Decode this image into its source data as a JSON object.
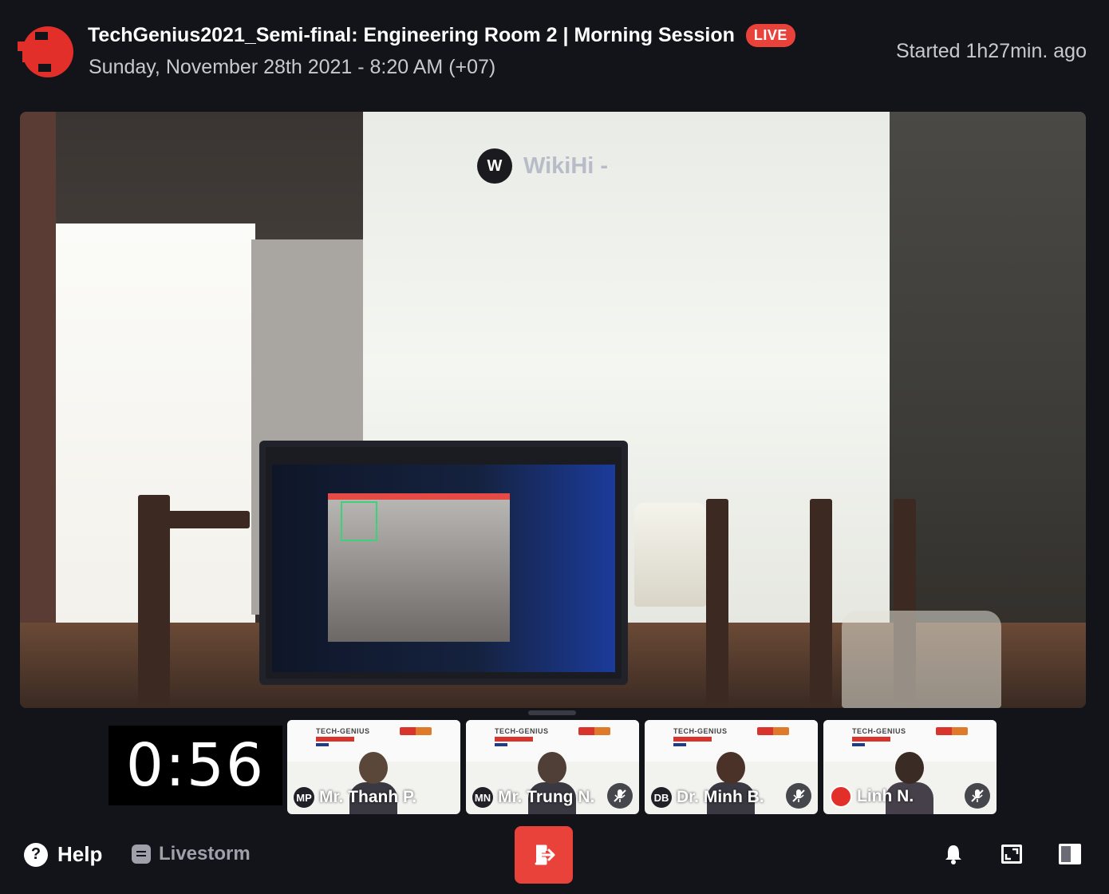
{
  "header": {
    "title": "TechGenius2021_Semi-final: Engineering Room 2 | Morning Session",
    "live_badge": "LIVE",
    "date": "Sunday, November 28th 2021 - 8:20 AM (+07)",
    "started": "Started 1h27min. ago"
  },
  "stage": {
    "speaker_initial": "W",
    "speaker_name": "WikiHi -"
  },
  "timer": "0:56",
  "participants": [
    {
      "initials": "MP",
      "name": "Mr. Thanh P.",
      "muted": false,
      "tile_brand": "TECH-GENIUS"
    },
    {
      "initials": "MN",
      "name": "Mr. Trung N.",
      "muted": true,
      "tile_brand": "TECH-GENIUS"
    },
    {
      "initials": "DB",
      "name": "Dr. Minh B.",
      "muted": true,
      "tile_brand": "TECH-GENIUS"
    },
    {
      "initials": "",
      "name": "Linh N.",
      "muted": true,
      "tile_brand": "TECH-GENIUS"
    }
  ],
  "footer": {
    "help_label": "Help",
    "brand_label": "Livestorm"
  },
  "colors": {
    "background": "#13131a",
    "accent": "#e8423b",
    "muted_text": "#c8c8cf"
  },
  "icons": [
    "logo-icon",
    "help-icon",
    "livestorm-icon",
    "leave-icon",
    "bell-icon",
    "fullscreen-icon",
    "layout-icon",
    "mic-off-icon"
  ]
}
